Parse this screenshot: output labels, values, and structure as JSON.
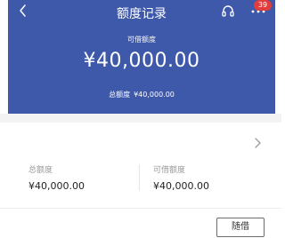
{
  "header": {
    "title": "额度记录",
    "badge_count": "39",
    "available_label": "可借额度",
    "available_amount": "¥40,000.00",
    "total_label": "总额度",
    "total_amount": "¥40,000.00",
    "bg_color": "#3e59a9",
    "icons": [
      "back-icon",
      "headset-icon",
      "more-icon"
    ]
  },
  "summary": {
    "total_label": "总额度",
    "total_value": "¥40,000.00",
    "available_label": "可借额度",
    "available_value": "¥40,000.00",
    "icon": "chevron-right-icon"
  },
  "footer": {
    "borrow_button": "随借"
  }
}
